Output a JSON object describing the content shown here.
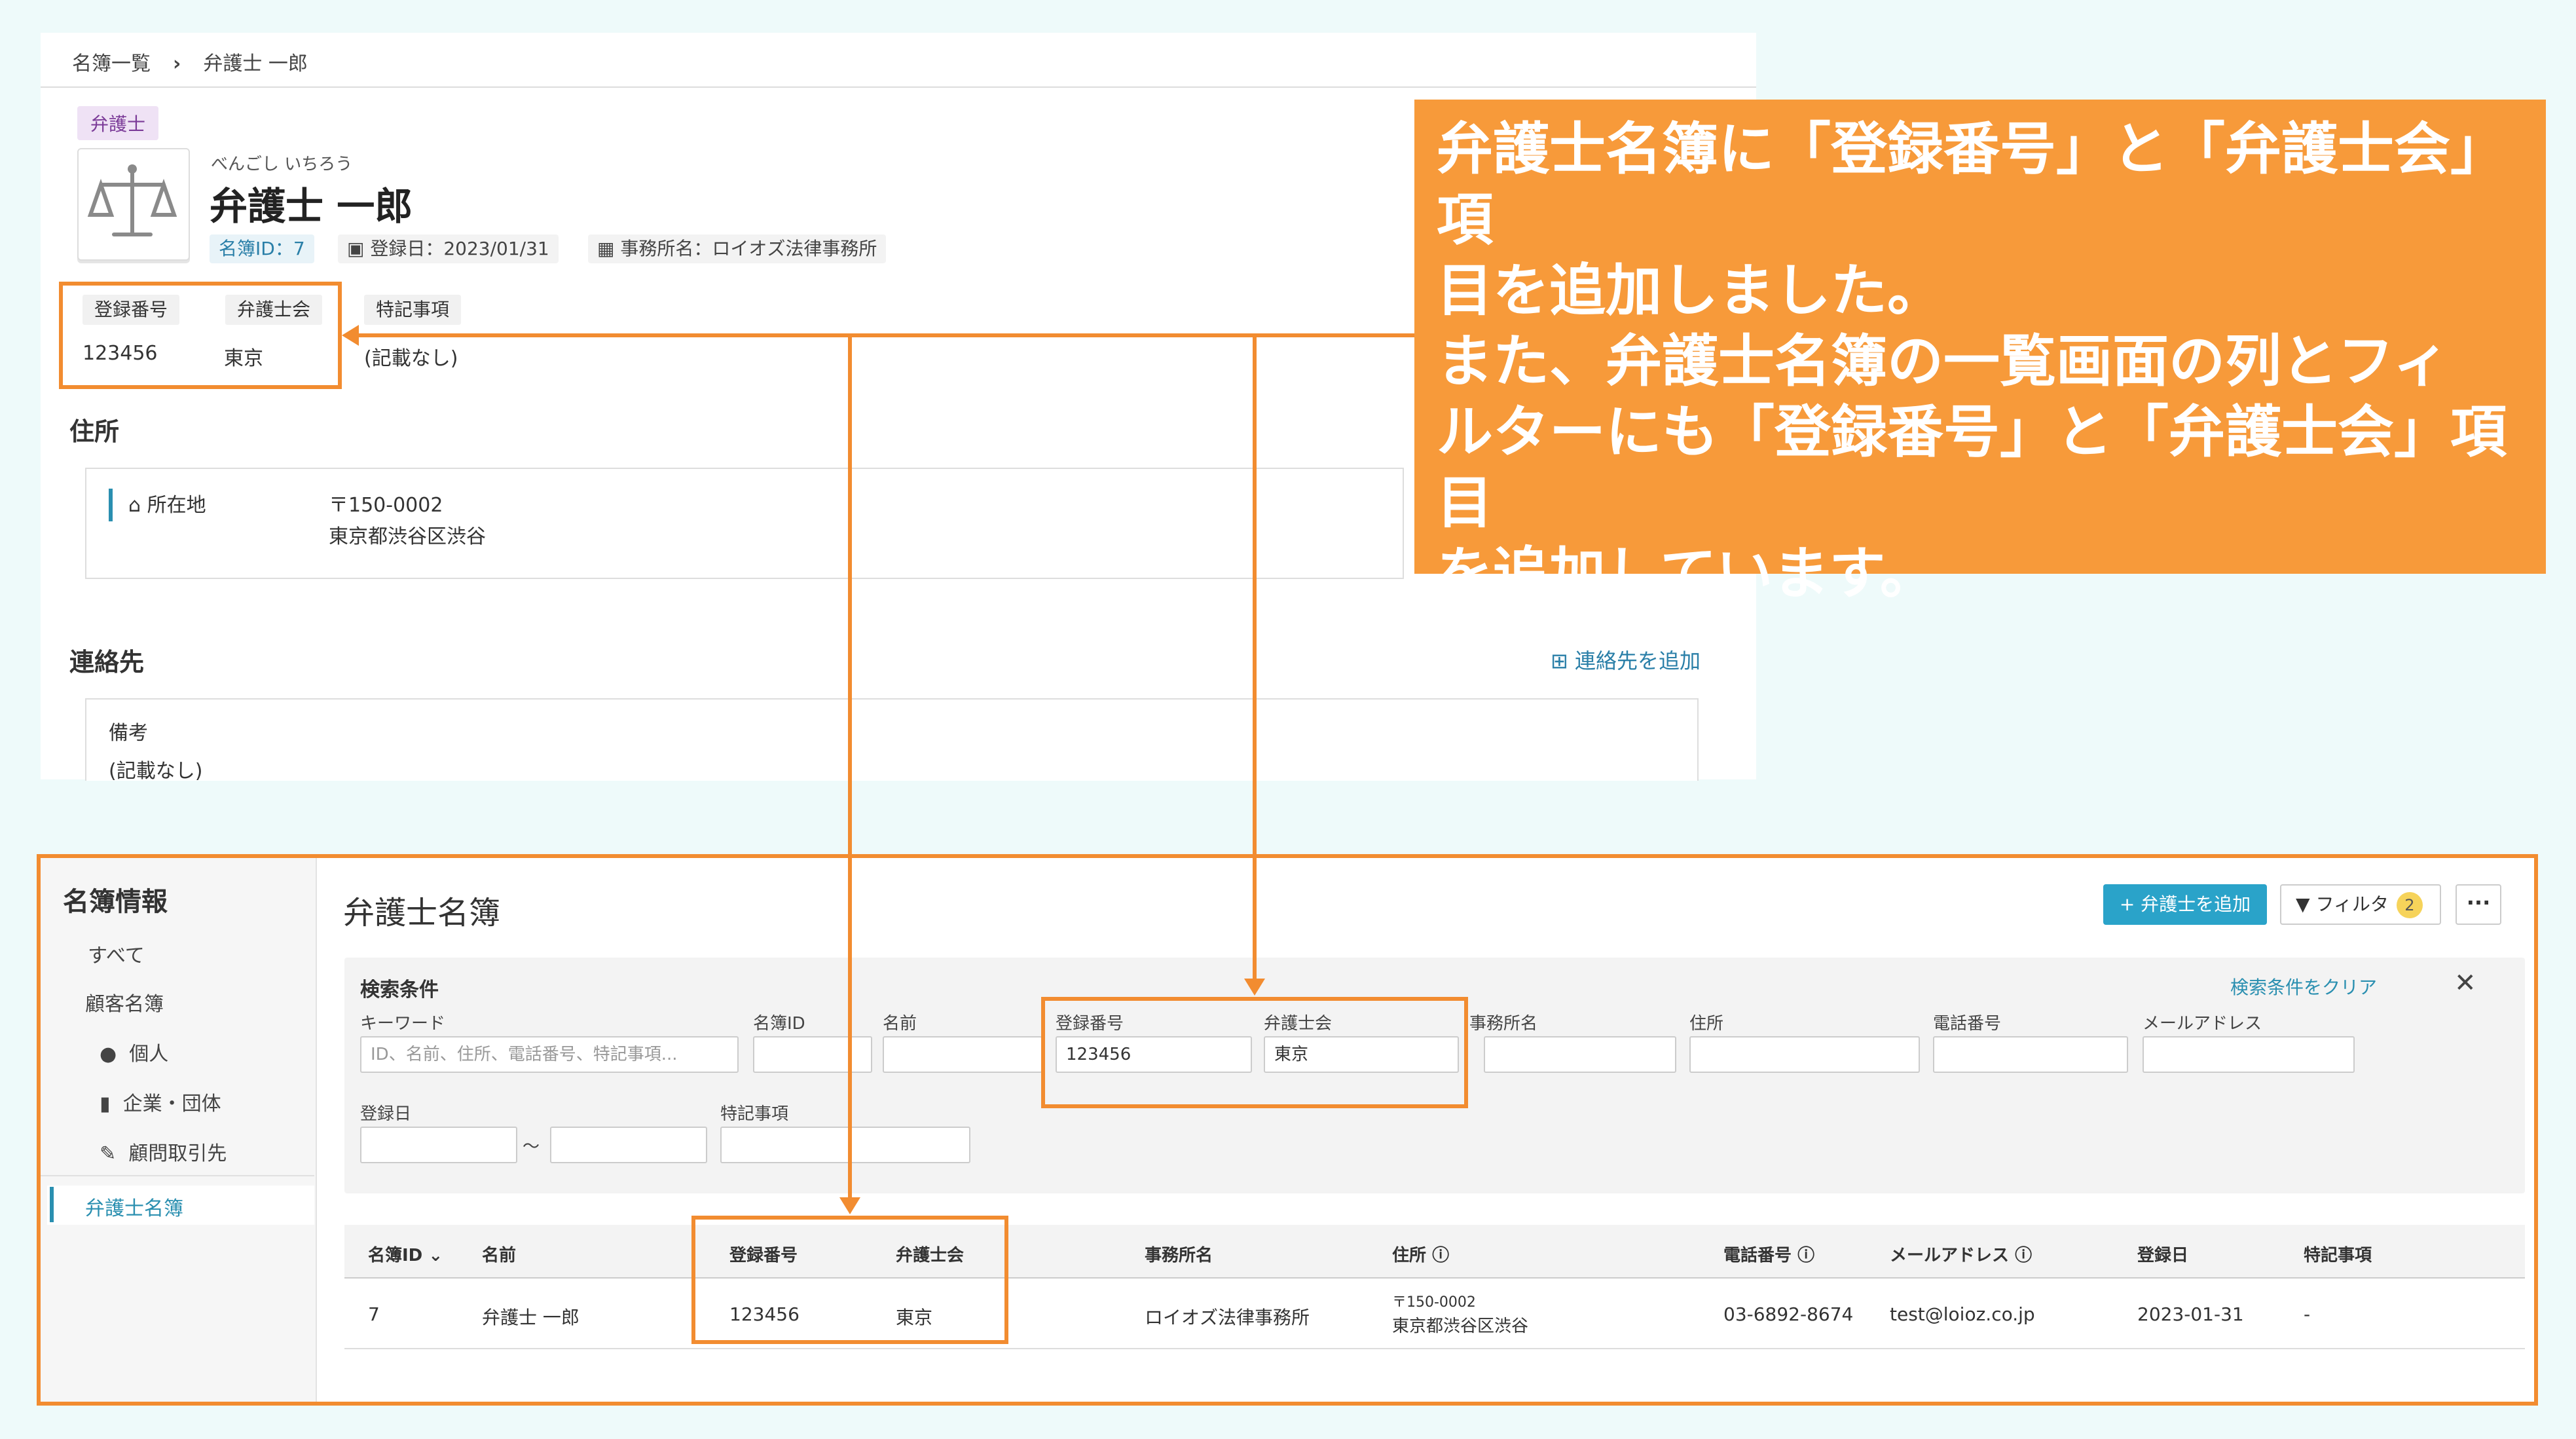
{
  "detail": {
    "breadcrumb": {
      "root": "名簿一覧",
      "separator": "›",
      "current": "弁護士 一郎"
    },
    "tag": "弁護士",
    "kana": "べんごし いちろう",
    "name": "弁護士 一郎",
    "chips": {
      "id": "名簿ID：7",
      "registered": "登録日：2023/01/31",
      "office": "事務所名：ロイオズ法律事務所"
    },
    "fields": {
      "reg_no_label": "登録番号",
      "reg_no_value": "123456",
      "bar_label": "弁護士会",
      "bar_value": "東京",
      "notes_label": "特記事項",
      "notes_value": "(記載なし)"
    },
    "address": {
      "section": "住所",
      "label": "所在地",
      "postal": "〒150-0002",
      "line": "東京都渋谷区渋谷"
    },
    "contact": {
      "section": "連絡先",
      "add_label": "連絡先を追加",
      "memo_label": "備考",
      "memo_value": "(記載なし)"
    }
  },
  "callout": {
    "line1": "弁護士名簿に「登録番号」と「弁護士会」項",
    "line2": "目を追加しました。",
    "line3": "また、弁護士名簿の一覧画面の列とフィ",
    "line4": "ルターにも「登録番号」と「弁護士会」項目",
    "line5": "を追加しています。"
  },
  "list": {
    "sidebar": {
      "title": "名簿情報",
      "all": "すべて",
      "clients": "顧客名簿",
      "individual": "個人",
      "company": "企業・団体",
      "advisory": "顧問取引先",
      "lawyers": "弁護士名簿"
    },
    "title": "弁護士名簿",
    "add_button": "+ 弁護士を追加",
    "filter_button": "フィルタ",
    "filter_count": "2",
    "more_button": "···",
    "search": {
      "title": "検索条件",
      "clear": "検索条件をクリア",
      "close": "✕",
      "keyword_label": "キーワード",
      "keyword_placeholder": "ID、名前、住所、電話番号、特記事項...",
      "id_label": "名簿ID",
      "name_label": "名前",
      "reg_no_label": "登録番号",
      "reg_no_value": "123456",
      "bar_label": "弁護士会",
      "bar_value": "東京",
      "office_label": "事務所名",
      "address_label": "住所",
      "phone_label": "電話番号",
      "email_label": "メールアドレス",
      "date_label": "登録日",
      "date_sep": "〜",
      "notes_label": "特記事項"
    },
    "columns": {
      "id": "名簿ID",
      "name": "名前",
      "reg_no": "登録番号",
      "bar": "弁護士会",
      "office": "事務所名",
      "address": "住所",
      "phone": "電話番号",
      "email": "メールアドレス",
      "date": "登録日",
      "notes": "特記事項"
    },
    "row": {
      "id": "7",
      "name": "弁護士 一郎",
      "reg_no": "123456",
      "bar": "東京",
      "office": "ロイオズ法律事務所",
      "postal": "〒150-0002",
      "address": "東京都渋谷区渋谷",
      "phone": "03-6892-8674",
      "email": "test@loioz.co.jp",
      "date": "2023-01-31",
      "notes": "-"
    }
  },
  "colors": {
    "accent_orange": "#f28c30",
    "callout_orange": "#f79a3a",
    "teal": "#2aa3c9"
  },
  "icons": [
    "scales-icon",
    "calendar-icon",
    "building-icon",
    "home-icon",
    "plus-square-icon",
    "person-icon",
    "filter-icon",
    "help-circle-icon",
    "chevron-down-icon",
    "close-icon"
  ]
}
